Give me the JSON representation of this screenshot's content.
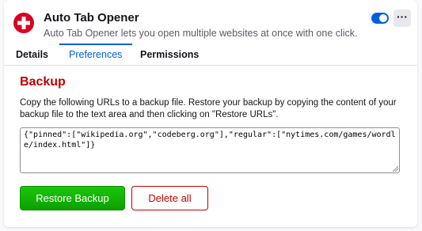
{
  "header": {
    "app_name": "Auto Tab Opener",
    "app_description": "Auto Tab Opener lets you open multiple websites at once with one click.",
    "app_icon": "red-circle-plus-icon",
    "toggle_enabled": true,
    "more_label": "···"
  },
  "tabs": [
    {
      "label": "Details",
      "active": false
    },
    {
      "label": "Preferences",
      "active": true
    },
    {
      "label": "Permissions",
      "active": false
    }
  ],
  "backup": {
    "title": "Backup",
    "description": "Copy the following URLs to a backup file. Restore your backup by copying the content of your backup file to the text area and then clicking on \"Restore URLs\".",
    "textarea_value": "{\"pinned\":[\"wikipedia.org\",\"codeberg.org\"],\"regular\":[\"nytimes.com/games/wordle/index.html\"]}",
    "restore_label": "Restore Backup",
    "delete_label": "Delete all"
  },
  "colors": {
    "accent": "#0061e0",
    "title_red": "#c00000",
    "restore_green": "#12bc00"
  }
}
